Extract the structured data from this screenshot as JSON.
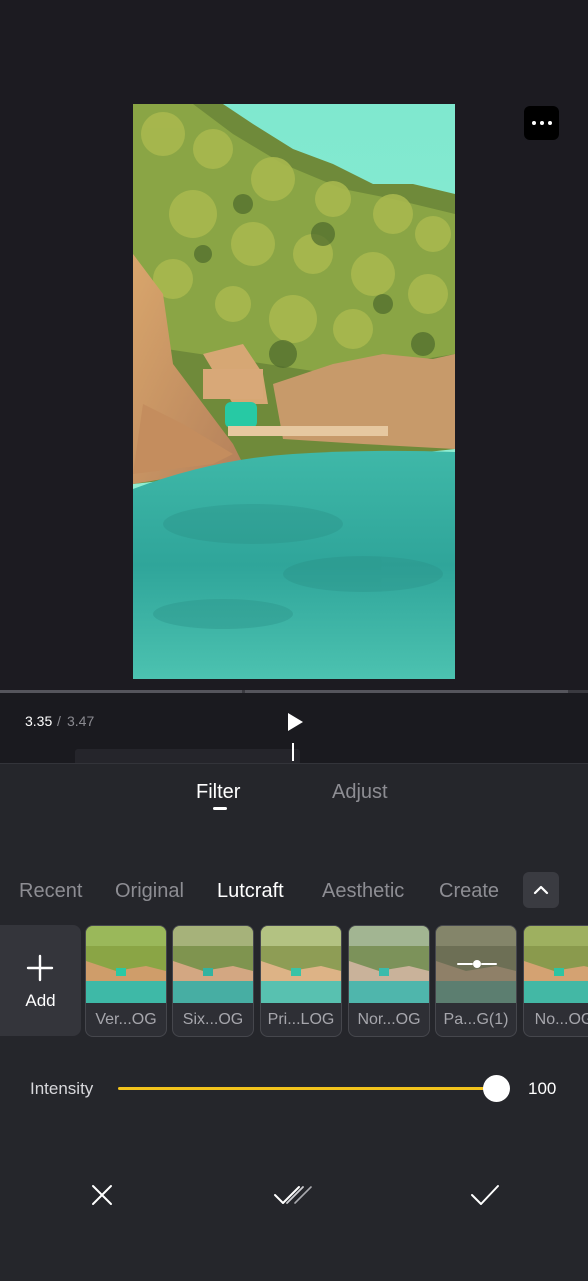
{
  "player": {
    "current_time": "3.35",
    "separator": "/",
    "total_time": "3.47",
    "more_icon": "more-dots-icon",
    "play_icon": "play-icon"
  },
  "tabs": [
    {
      "label": "Filter",
      "active": true
    },
    {
      "label": "Adjust",
      "active": false
    }
  ],
  "categories": [
    {
      "label": "Recent",
      "active": false
    },
    {
      "label": "Original",
      "active": false
    },
    {
      "label": "Lutcraft",
      "active": true
    },
    {
      "label": "Aesthetic",
      "active": false
    },
    {
      "label": "Create",
      "active": false
    }
  ],
  "collapse_icon": "chevron-up-icon",
  "add": {
    "label": "Add",
    "icon": "plus-icon"
  },
  "filters": [
    {
      "label": "Ver...OG"
    },
    {
      "label": "Six...OG"
    },
    {
      "label": "Pri...LOG"
    },
    {
      "label": "Nor...OG"
    },
    {
      "label": "Pa...G(1)"
    },
    {
      "label": "No...OG"
    }
  ],
  "intensity": {
    "label": "Intensity",
    "value": "100",
    "level": 1.0
  },
  "actions": {
    "cancel_icon": "close-icon",
    "apply_all_icon": "double-check-icon",
    "confirm_icon": "check-icon"
  },
  "colors": {
    "accent": "#f2c31c",
    "background": "#1c1c21",
    "panel": "#25262b"
  }
}
